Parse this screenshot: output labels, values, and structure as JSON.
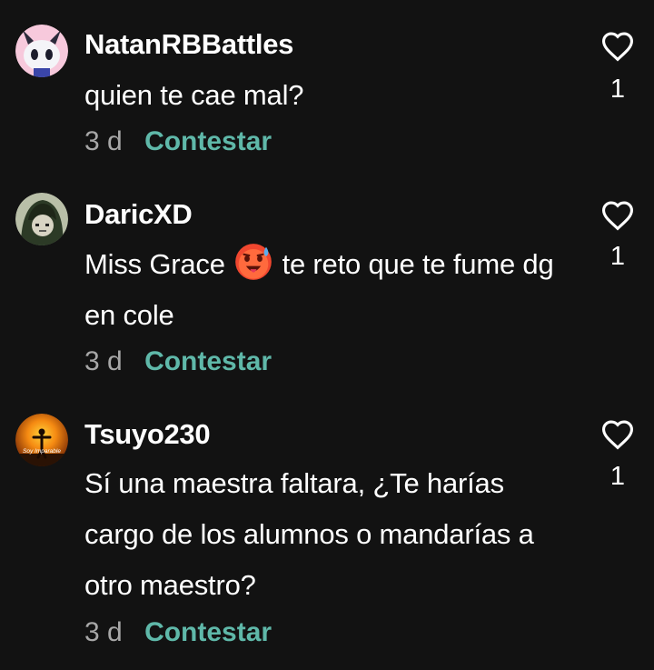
{
  "comments": [
    {
      "username": "NatanRBBattles",
      "text": "quien te cae mal?",
      "time": "3 d",
      "reply_label": "Contestar",
      "likes": "1",
      "avatar_icon": "ghost-face-icon"
    },
    {
      "username": "DaricXD",
      "text_before_emoji": "Miss Grace ",
      "emoji": "hot-face-emoji",
      "text_after_emoji": " te reto que te fume dg en cole",
      "time": "3 d",
      "reply_label": "Contestar",
      "likes": "1",
      "avatar_icon": "hooded-character-icon"
    },
    {
      "username": "Tsuyo230",
      "text": "Sí una maestra faltara, ¿Te harías cargo de los alumnos o mandarías a otro maestro?",
      "time": "3 d",
      "reply_label": "Contestar",
      "likes": "1",
      "avatar_icon": "sunset-silhouette-icon",
      "avatar_text": "Soy Imparable"
    }
  ],
  "colors": {
    "background": "#121212",
    "reply": "#5fb8a9",
    "time": "#a7a7a7"
  }
}
